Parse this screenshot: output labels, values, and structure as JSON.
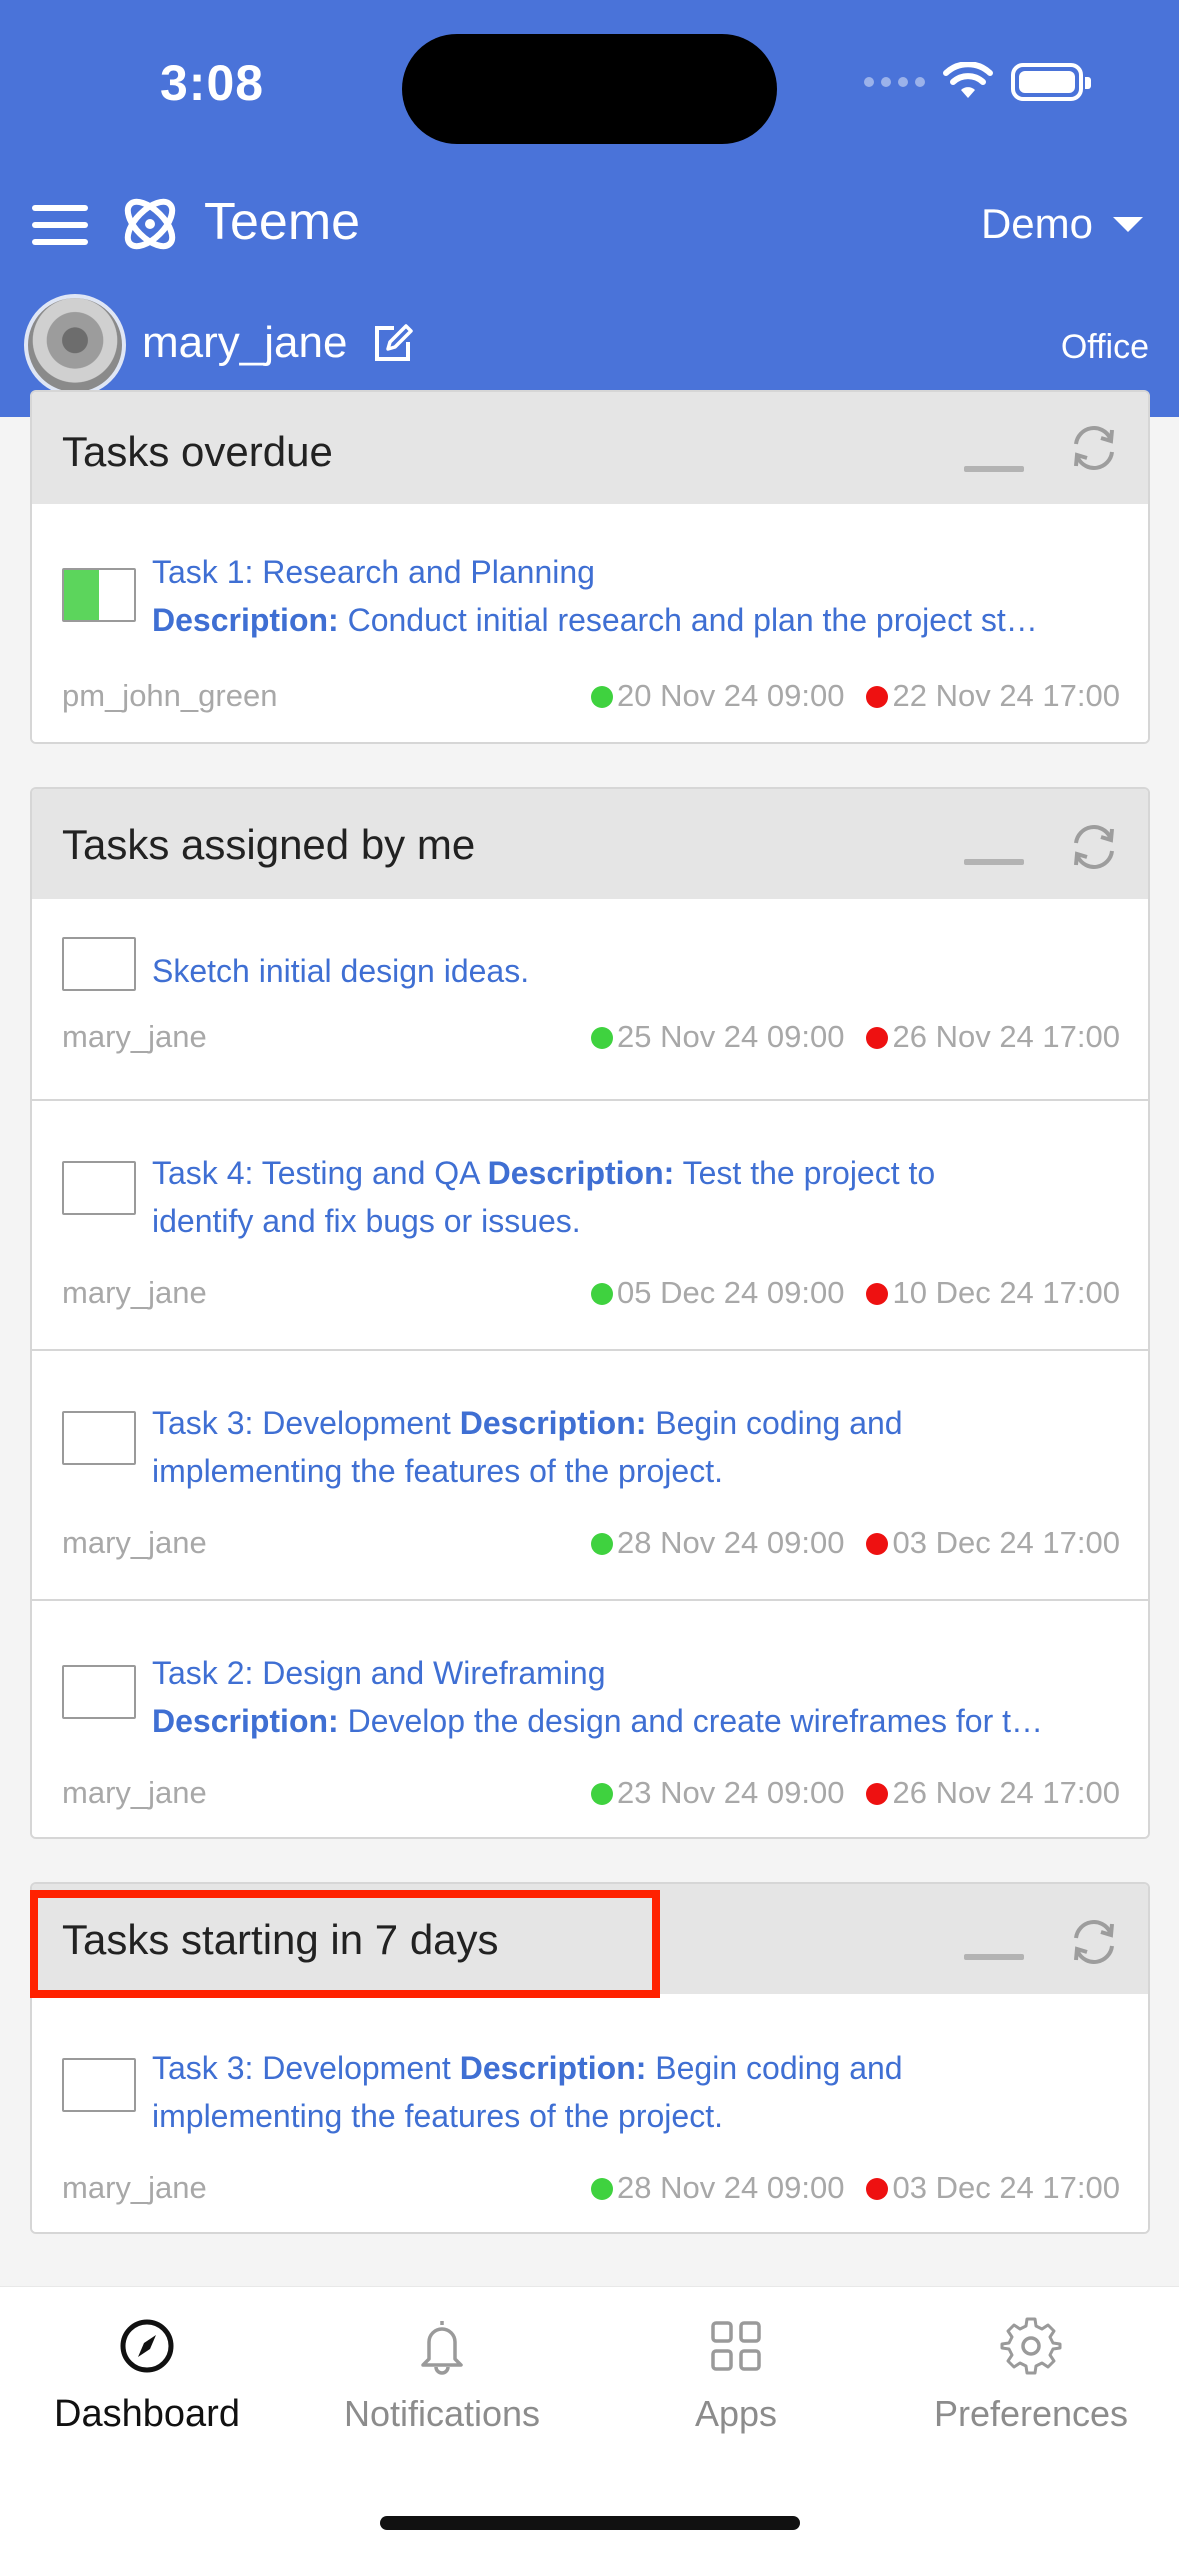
{
  "status_bar": {
    "time": "3:08"
  },
  "header": {
    "app_name": "Teeme",
    "org_selector": "Demo",
    "username": "mary_jane",
    "location": "Office",
    "colors": {
      "header_bg": "#4a73d9"
    }
  },
  "panels": [
    {
      "title": "Tasks overdue",
      "tasks": [
        {
          "checkbox_state": "partial",
          "title": "Task 1: Research and Planning",
          "desc_label": "Description:",
          "description": "Conduct initial research and plan the project st…",
          "user": "pm_john_green",
          "start": "20 Nov 24 09:00",
          "end": "22 Nov 24 17:00"
        }
      ]
    },
    {
      "title": "Tasks assigned by me",
      "tasks": [
        {
          "title": "Sketch initial design ideas.",
          "user": "mary_jane",
          "start": "25 Nov 24 09:00",
          "end": "26 Nov 24 17:00"
        },
        {
          "title": "Task 4: Testing and QA",
          "desc_label": "Description:",
          "desc_inline": "Test the project to",
          "desc_cont": "identify and fix bugs or issues.",
          "user": "mary_jane",
          "start": "05 Dec 24 09:00",
          "end": "10 Dec 24 17:00"
        },
        {
          "title": "Task 3: Development",
          "desc_label": "Description:",
          "desc_inline": "Begin coding and",
          "desc_cont": "implementing the features of the project.",
          "user": "mary_jane",
          "start": "28 Nov 24 09:00",
          "end": "03 Dec 24 17:00"
        },
        {
          "title": "Task 2: Design and Wireframing",
          "desc_label": "Description:",
          "description": "Develop the design and create wireframes for t…",
          "user": "mary_jane",
          "start": "23 Nov 24 09:00",
          "end": "26 Nov 24 17:00"
        }
      ]
    },
    {
      "title": "Tasks starting in 7 days",
      "tasks": [
        {
          "title": "Task 3: Development",
          "desc_label": "Description:",
          "desc_inline": "Begin coding and",
          "desc_cont": "implementing the features of the project.",
          "user": "mary_jane",
          "start": "28 Nov 24 09:00",
          "end": "03 Dec 24 17:00"
        }
      ]
    }
  ],
  "bottom_nav": {
    "items": [
      {
        "label": "Dashboard",
        "icon": "compass-icon",
        "active": true
      },
      {
        "label": "Notifications",
        "icon": "bell-icon"
      },
      {
        "label": "Apps",
        "icon": "grid-icon"
      },
      {
        "label": "Preferences",
        "icon": "gear-icon"
      }
    ]
  }
}
